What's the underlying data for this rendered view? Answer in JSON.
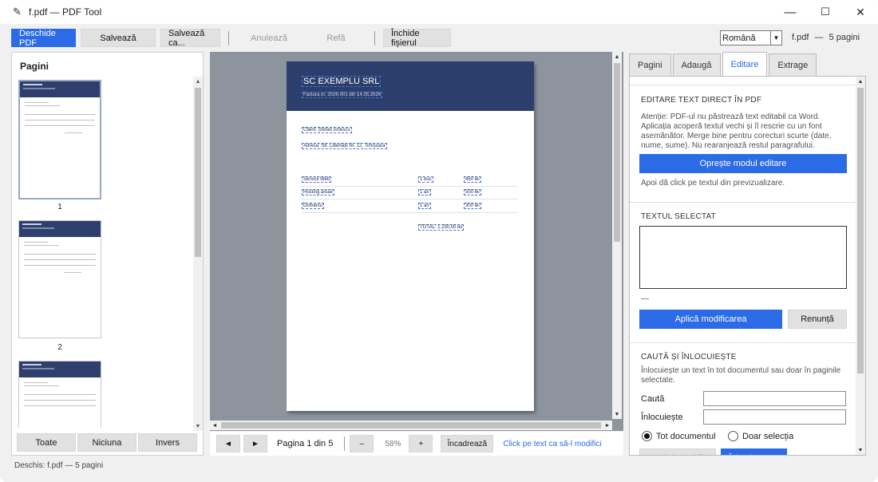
{
  "window": {
    "title": "f.pdf — PDF Tool",
    "minimize": "—",
    "maximize": "☐",
    "close": "✕"
  },
  "toolbar": {
    "open": "Deschide PDF",
    "save": "Salvează",
    "save_as": "Salvează ca...",
    "undo": "Anulează",
    "redo": "Refă",
    "close_file": "Închide fișierul",
    "language": "Română",
    "file_name": "f.pdf",
    "file_sep": "—",
    "page_count": "5 pagini"
  },
  "pages_panel": {
    "header": "Pagini",
    "thumbs": [
      {
        "num": "1"
      },
      {
        "num": "2"
      },
      {
        "num": ""
      }
    ],
    "buttons": {
      "all": "Toate",
      "none": "Niciuna",
      "invert": "Invers"
    }
  },
  "preview": {
    "company": "SC EXEMPLU SRL",
    "invoice": "Factura nr. 2026-001 din 14.05.2026",
    "client": "Client: Ștefan Ionescu",
    "address": "Adresa: Str. Libertății Nr. 12, Timișoara",
    "rows": [
      {
        "item": "Servicii Web",
        "qty": "1 buc",
        "price": "450 lei"
      },
      {
        "item": "Hosting anual",
        "qty": "1 an",
        "price": "500 lei"
      },
      {
        "item": "Domeniu",
        "qty": "1 an",
        "price": "300 lei"
      }
    ],
    "total": "TOTAL: 1.250,00 lei"
  },
  "nav": {
    "prev": "◄",
    "next": "►",
    "page_label": "Pagina 1 din 5",
    "zoom_out": "–",
    "zoom": "58%",
    "zoom_in": "+",
    "fit": "Încadrează",
    "hint": "Click pe text ca să-l modifici"
  },
  "right_panel": {
    "tabs": [
      "Pagini",
      "Adaugă",
      "Editare",
      "Extrage"
    ],
    "active_tab": "Editare",
    "edit_header": "EDITARE TEXT DIRECT ÎN PDF",
    "edit_desc": "Atenție: PDF-ul nu păstrează text editabil ca Word. Aplicația acoperă textul vechi și îl rescrie cu un font asemănător. Merge bine pentru corecturi scurte (date, nume, sume). Nu rearanjează restul paragrafului.",
    "stop_edit": "Oprește modul editare",
    "then_click": "Apoi dă click pe textul din previzualizare.",
    "selected_header": "TEXTUL SELECTAT",
    "selected_value": "",
    "selected_dash": "—",
    "apply": "Aplică modificarea",
    "cancel": "Renunță",
    "find_header": "CAUTĂ ȘI ÎNLOCUIEȘTE",
    "find_desc": "Înlocuiește un text în tot documentul sau doar în paginile selectate.",
    "find_label": "Caută",
    "replace_label": "Înlocuiește",
    "find_value": "",
    "replace_value": "",
    "scope_all": "Tot documentul",
    "scope_sel": "Doar selecția",
    "btn_count": "Numără aparițiile",
    "btn_replace": "Înlocuiește tot"
  },
  "status": "Deschis: f.pdf — 5 pagini"
}
